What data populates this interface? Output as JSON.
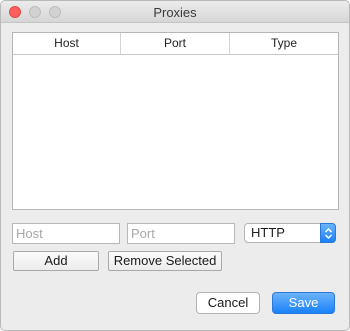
{
  "window": {
    "title": "Proxies"
  },
  "table": {
    "columns": [
      "Host",
      "Port",
      "Type"
    ],
    "rows": []
  },
  "form": {
    "host_placeholder": "Host",
    "port_placeholder": "Port",
    "type_selected": "HTTP"
  },
  "buttons": {
    "add": "Add",
    "remove_selected": "Remove Selected",
    "cancel": "Cancel",
    "save": "Save"
  },
  "colors": {
    "accent": "#1a82fb",
    "close": "#fc605c"
  }
}
